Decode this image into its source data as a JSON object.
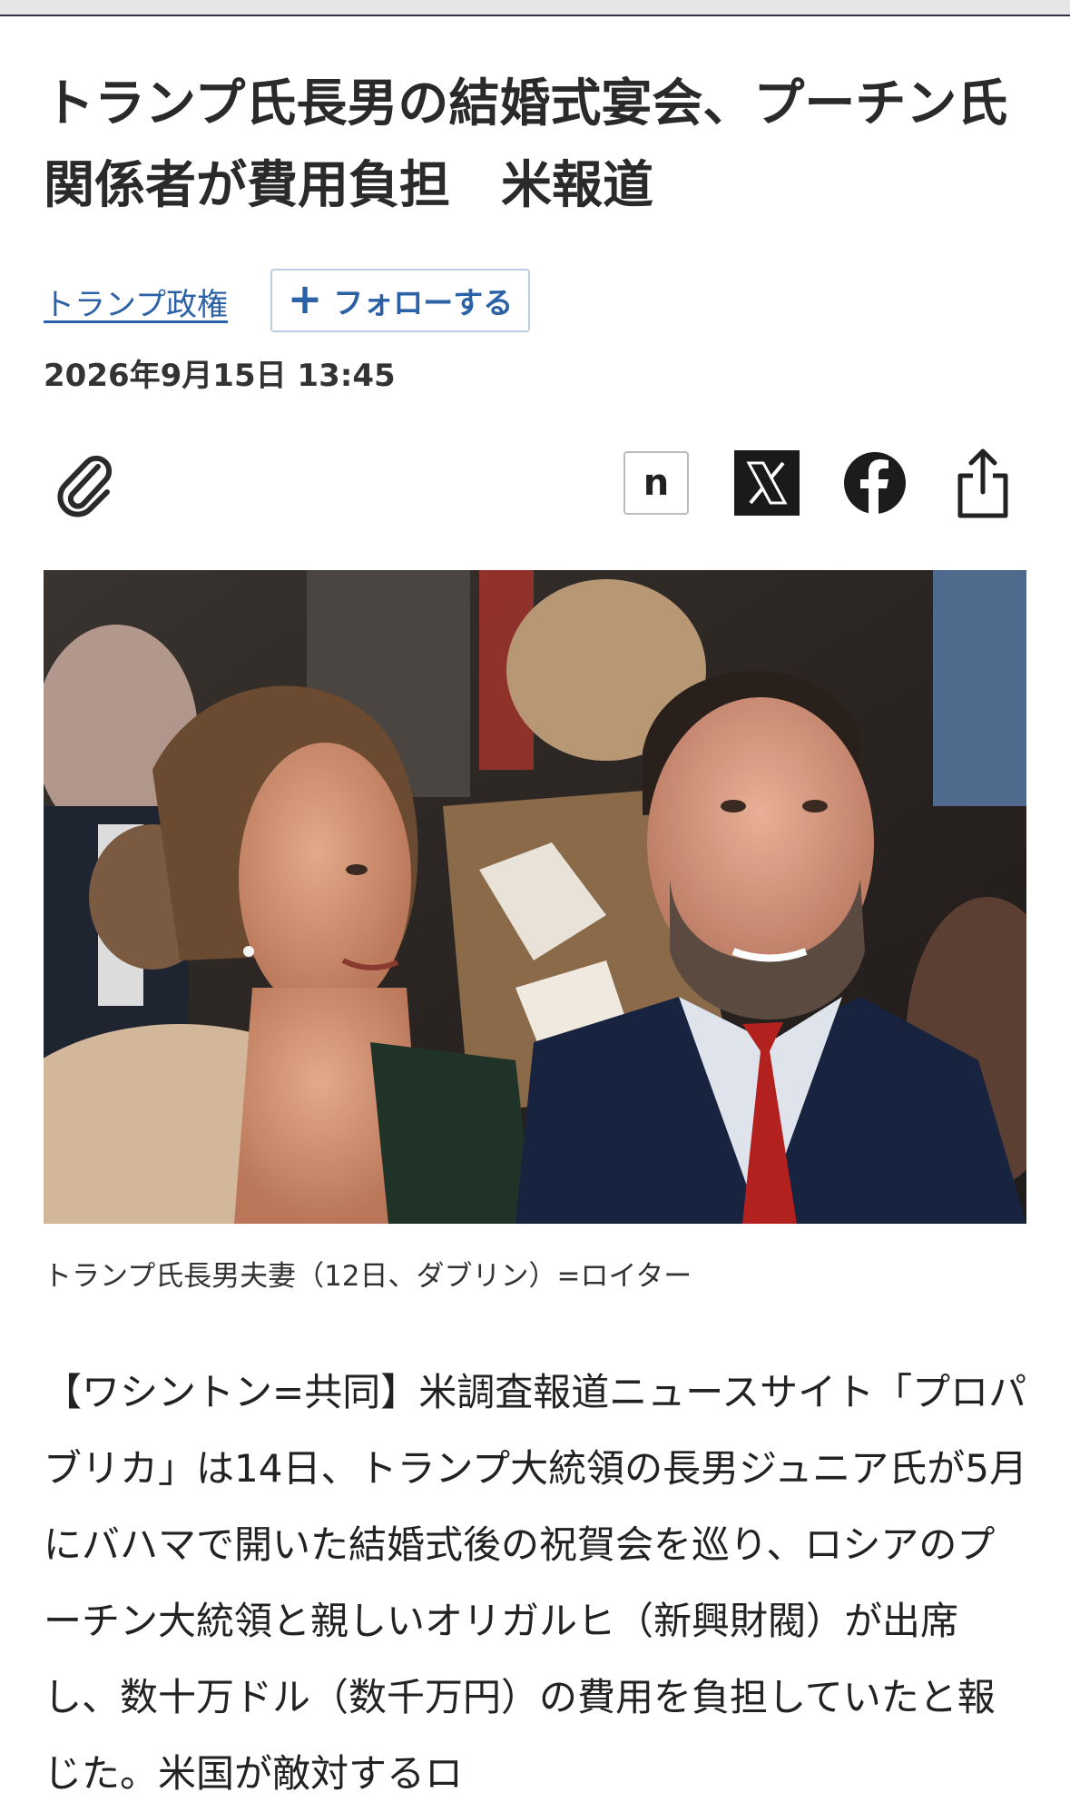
{
  "article": {
    "headline": "トランプ氏長男の結婚式宴会、プーチン氏\n関係者が費用負担　米報道",
    "topic_link": "トランプ政権",
    "follow_label": "フォローする",
    "follow_icon": "plus-icon",
    "date": "2026年9月15日 13:45"
  },
  "toolbar": {
    "icons": [
      "paperclip-icon",
      "note-icon",
      "x-icon",
      "facebook-icon",
      "share-icon"
    ],
    "note_letter": "n"
  },
  "photo": {
    "caption": "トランプ氏長男夫妻（12日、ダブリン）=ロイター"
  },
  "body": {
    "text": "【ワシントン=共同】米調査報道ニュースサイト「プロパブリカ」は14日、トランプ大統領の長男ジュニア氏が5月にバハマで開いた結婚式後の祝賀会を巡り、ロシアのプーチン大統領と親しいオリガルヒ（新興財閥）が出席し、数十万ドル（数千万円）の費用を負担していたと報じた。米国が敵対するロ"
  },
  "colors": {
    "link": "#2b62a6",
    "follow_border": "#b9cde3",
    "x_bg": "#1a1a1a",
    "facebook": "#1c1c1c"
  }
}
